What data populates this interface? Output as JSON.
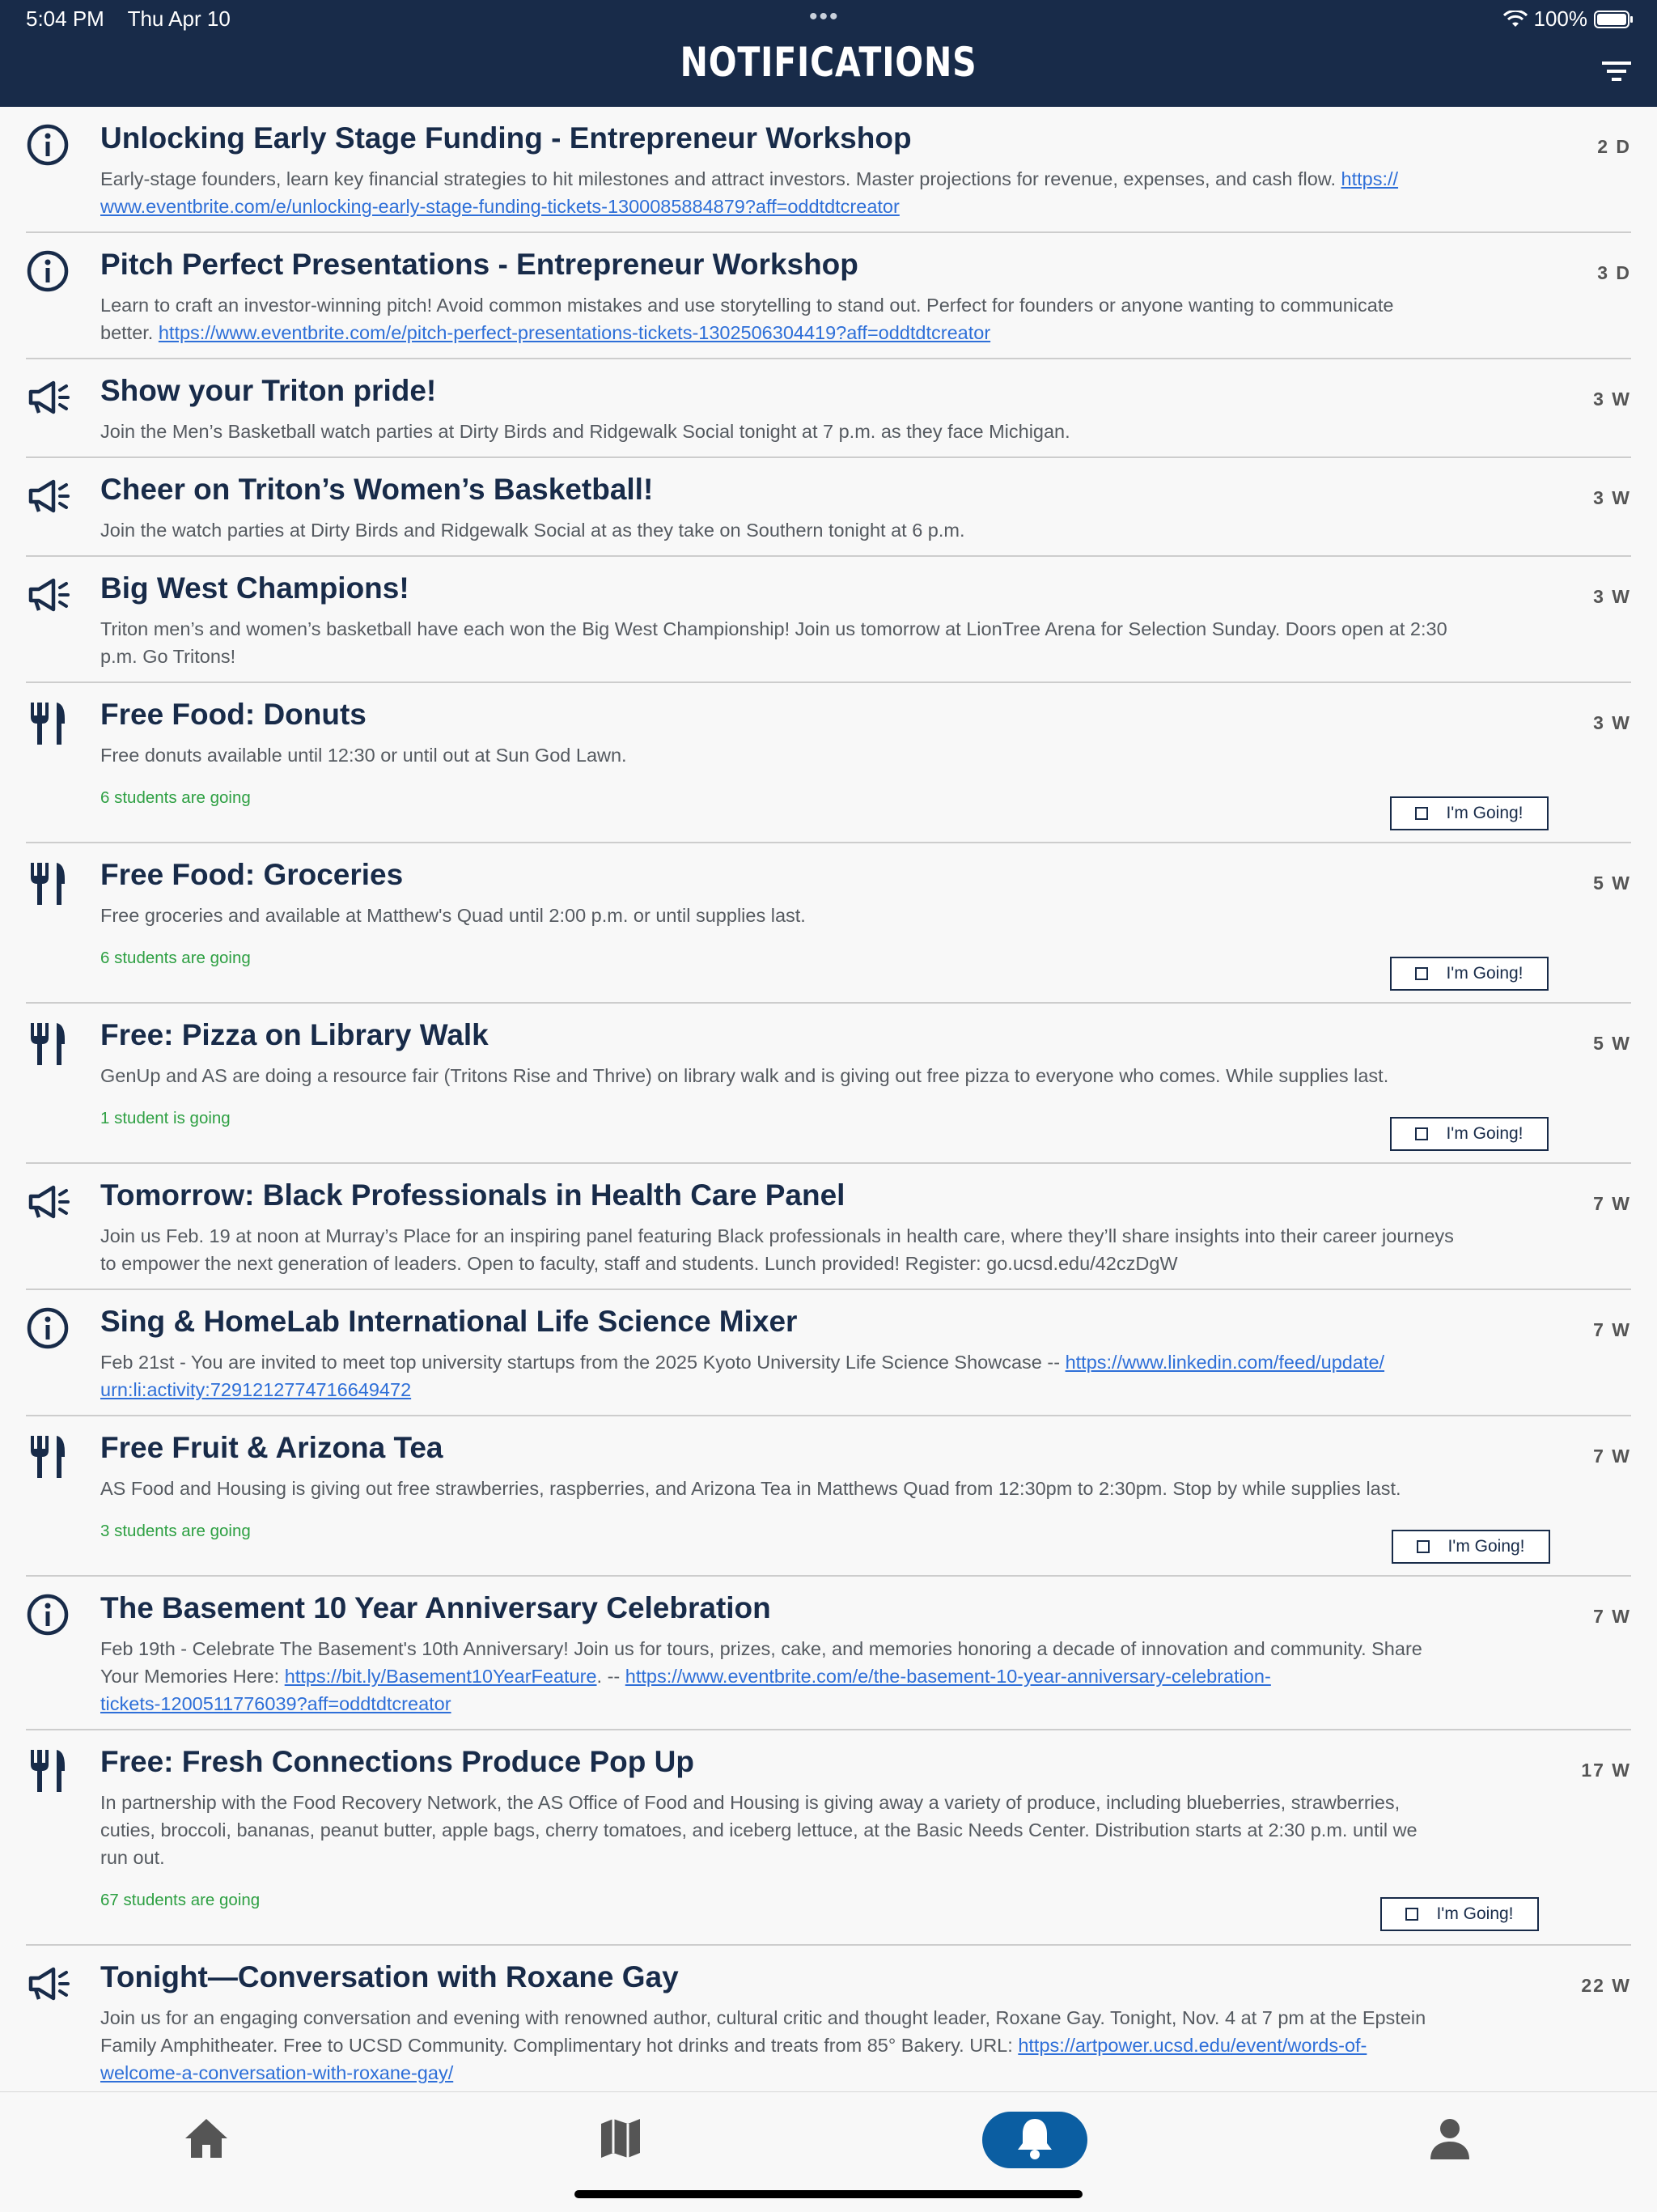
{
  "status": {
    "time": "5:04 PM",
    "date": "Thu Apr 10",
    "battery": "100%"
  },
  "header": {
    "title": "NOTIFICATIONS"
  },
  "colors": {
    "navy": "#182b49",
    "link": "#2e6fd8",
    "going": "#2ea043",
    "active_tab": "#0b5ea2"
  },
  "notifications": [
    {
      "icon": "info-icon",
      "title": "Unlocking Early Stage Funding - Entrepreneur Workshop",
      "age": "2 D",
      "desc_lines": [
        [
          {
            "t": "Early-stage founders, learn key financial strategies to hit milestones and attract investors. Master projections for revenue, expenses, and cash flow. "
          },
          {
            "t": "https://",
            "link": true
          }
        ],
        [
          {
            "t": "www.eventbrite.com/e/unlocking-early-stage-funding-tickets-1300085884879?aff=oddtdtcreator",
            "link": true
          }
        ]
      ]
    },
    {
      "icon": "info-icon",
      "title": "Pitch Perfect Presentations - Entrepreneur Workshop",
      "age": "3 D",
      "desc_lines": [
        [
          {
            "t": "Learn to craft an investor-winning pitch! Avoid common mistakes and use storytelling to stand out. Perfect for founders or anyone wanting to communicate"
          }
        ],
        [
          {
            "t": "better. "
          },
          {
            "t": "https://www.eventbrite.com/e/pitch-perfect-presentations-tickets-1302506304419?aff=oddtdtcreator",
            "link": true
          }
        ]
      ]
    },
    {
      "icon": "megaphone-icon",
      "title": "Show your Triton pride!",
      "age": "3 W",
      "desc_lines": [
        [
          {
            "t": "Join the Men’s Basketball watch parties at Dirty Birds and Ridgewalk Social tonight at 7 p.m. as they face Michigan."
          }
        ]
      ]
    },
    {
      "icon": "megaphone-icon",
      "title": "Cheer on Triton’s Women’s Basketball!",
      "age": "3 W",
      "desc_lines": [
        [
          {
            "t": "Join the watch parties at Dirty Birds and Ridgewalk Social at as they take on Southern tonight at 6 p.m."
          }
        ]
      ]
    },
    {
      "icon": "megaphone-icon",
      "title": "Big West Champions!",
      "age": "3 W",
      "desc_lines": [
        [
          {
            "t": "Triton men’s and women’s basketball have each won the Big West Championship! Join us tomorrow at LionTree Arena for Selection Sunday. Doors open at 2:30"
          }
        ],
        [
          {
            "t": "p.m. Go Tritons!"
          }
        ]
      ]
    },
    {
      "icon": "fork-knife-icon",
      "title": "Free Food: Donuts",
      "age": "3 W",
      "desc_lines": [
        [
          {
            "t": "Free donuts available until 12:30 or until out at Sun God Lawn."
          }
        ]
      ],
      "going": "6 students are going",
      "button": "I'm Going!"
    },
    {
      "icon": "fork-knife-icon",
      "title": "Free Food: Groceries",
      "age": "5 W",
      "desc_lines": [
        [
          {
            "t": "Free groceries and available at Matthew's Quad until 2:00 p.m. or until supplies last."
          }
        ]
      ],
      "going": "6 students are going",
      "button": "I'm Going!"
    },
    {
      "icon": "fork-knife-icon",
      "title": "Free: Pizza on Library Walk",
      "age": "5 W",
      "desc_lines": [
        [
          {
            "t": "GenUp and AS are doing a resource fair (Tritons Rise and Thrive) on library walk and is giving out free pizza to everyone who comes. While supplies last."
          }
        ]
      ],
      "going": "1 student is going",
      "button": "I'm Going!"
    },
    {
      "icon": "megaphone-icon",
      "title": "Tomorrow: Black Professionals in Health Care Panel",
      "age": "7 W",
      "desc_lines": [
        [
          {
            "t": "Join us Feb. 19 at noon at Murray’s Place for an inspiring panel featuring Black professionals in health care, where they’ll share insights into their career journeys"
          }
        ],
        [
          {
            "t": "to empower the next generation of leaders. Open to faculty, staff and students. Lunch provided! Register: go.ucsd.edu/42czDgW"
          }
        ]
      ]
    },
    {
      "icon": "info-icon",
      "title": "Sing & HomeLab International Life Science Mixer",
      "age": "7 W",
      "desc_lines": [
        [
          {
            "t": "Feb 21st - You are invited to meet top university startups from the 2025 Kyoto University Life Science Showcase -- "
          },
          {
            "t": "https://www.linkedin.com/feed/update/",
            "link": true
          }
        ],
        [
          {
            "t": "urn:li:activity:7291212774716649472",
            "link": true
          }
        ]
      ]
    },
    {
      "icon": "fork-knife-icon",
      "title": "Free Fruit & Arizona Tea",
      "age": "7 W",
      "desc_lines": [
        [
          {
            "t": "AS Food and Housing is giving out free strawberries, raspberries, and Arizona Tea in Matthews Quad from 12:30pm to 2:30pm. Stop by while supplies last."
          }
        ]
      ],
      "going": "3 students are going",
      "button": "I'm Going!"
    },
    {
      "icon": "info-icon",
      "title": "The Basement 10 Year Anniversary Celebration",
      "age": "7 W",
      "desc_lines": [
        [
          {
            "t": "Feb 19th - Celebrate The Basement's 10th Anniversary! Join us for tours, prizes, cake, and memories honoring a decade of innovation and community. Share"
          }
        ],
        [
          {
            "t": "Your Memories Here: "
          },
          {
            "t": "https://bit.ly/Basement10YearFeature",
            "link": true
          },
          {
            "t": ". -- "
          },
          {
            "t": "https://www.eventbrite.com/e/the-basement-10-year-anniversary-celebration-",
            "link": true
          }
        ],
        [
          {
            "t": "tickets-1200511776039?aff=oddtdtcreator",
            "link": true
          }
        ]
      ]
    },
    {
      "icon": "fork-knife-icon",
      "title": "Free: Fresh Connections Produce Pop Up",
      "age": "17 W",
      "desc_lines": [
        [
          {
            "t": "In partnership with the Food Recovery Network, the AS Office of Food and Housing is giving away a variety of produce, including blueberries, strawberries,"
          }
        ],
        [
          {
            "t": "cuties, broccoli, bananas, peanut butter, apple bags, cherry tomatoes, and iceberg lettuce, at the Basic Needs Center. Distribution starts at 2:30 p.m. until we"
          }
        ],
        [
          {
            "t": "run out."
          }
        ]
      ],
      "going": "67 students are going",
      "button": "I'm Going!"
    },
    {
      "icon": "megaphone-icon",
      "title": "Tonight—Conversation with Roxane Gay",
      "age": "22 W",
      "desc_lines": [
        [
          {
            "t": "Join us for an engaging conversation and evening with renowned author, cultural critic and thought leader, Roxane Gay. Tonight, Nov. 4 at 7 pm at the Epstein"
          }
        ],
        [
          {
            "t": "Family Amphitheater. Free to UCSD Community. Complimentary hot drinks and treats from 85° Bakery. URL: "
          },
          {
            "t": "https://artpower.ucsd.edu/event/words-of-",
            "link": true
          }
        ],
        [
          {
            "t": "welcome-a-conversation-with-roxane-gay/",
            "link": true
          }
        ]
      ]
    }
  ],
  "tabbar": [
    {
      "name": "home",
      "icon": "home-icon",
      "active": false
    },
    {
      "name": "map",
      "icon": "map-icon",
      "active": false
    },
    {
      "name": "notifications",
      "icon": "bell-icon",
      "active": true
    },
    {
      "name": "profile",
      "icon": "person-icon",
      "active": false
    }
  ]
}
